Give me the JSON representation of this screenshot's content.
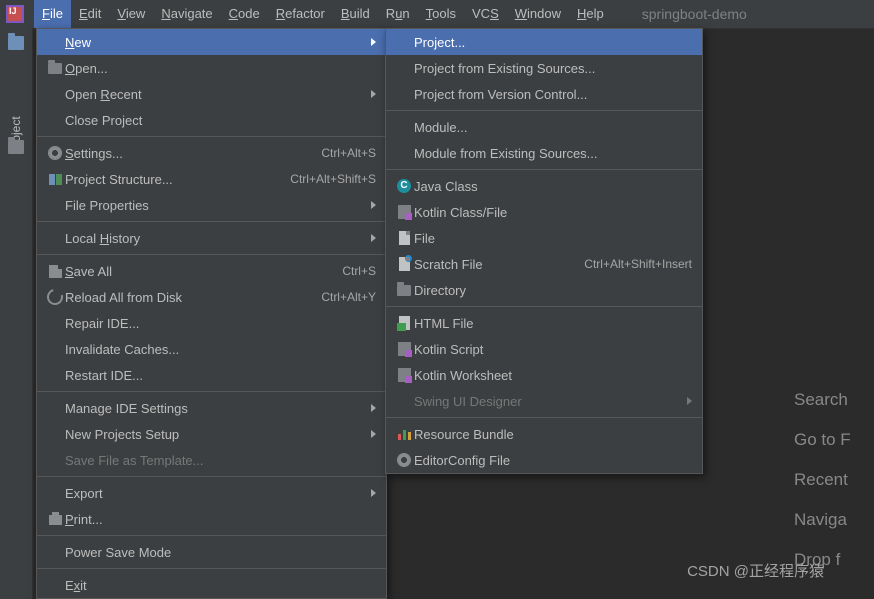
{
  "app": {
    "project_name": "springboot-demo"
  },
  "menubar": {
    "file": "File",
    "edit": "Edit",
    "view": "View",
    "navigate": "Navigate",
    "code": "Code",
    "refactor": "Refactor",
    "build": "Build",
    "run": "Run",
    "tools": "Tools",
    "vcs": "VCS",
    "window": "Window",
    "help": "Help"
  },
  "tool_stripe": {
    "project_label": "Project"
  },
  "file_menu": {
    "new": "New",
    "open": "Open...",
    "open_recent": "Open Recent",
    "close_project": "Close Project",
    "settings": "Settings...",
    "settings_sc": "Ctrl+Alt+S",
    "project_structure": "Project Structure...",
    "project_structure_sc": "Ctrl+Alt+Shift+S",
    "file_properties": "File Properties",
    "local_history": "Local History",
    "save_all": "Save All",
    "save_all_sc": "Ctrl+S",
    "reload_all": "Reload All from Disk",
    "reload_all_sc": "Ctrl+Alt+Y",
    "repair_ide": "Repair IDE...",
    "invalidate_caches": "Invalidate Caches...",
    "restart_ide": "Restart IDE...",
    "manage_ide_settings": "Manage IDE Settings",
    "new_projects_setup": "New Projects Setup",
    "save_file_as_template": "Save File as Template...",
    "export": "Export",
    "print": "Print...",
    "power_save": "Power Save Mode",
    "exit": "Exit"
  },
  "new_menu": {
    "project": "Project...",
    "project_existing": "Project from Existing Sources...",
    "project_vcs": "Project from Version Control...",
    "module": "Module...",
    "module_existing": "Module from Existing Sources...",
    "java_class": "Java Class",
    "kotlin_classfile": "Kotlin Class/File",
    "file": "File",
    "scratch": "Scratch File",
    "scratch_sc": "Ctrl+Alt+Shift+Insert",
    "directory": "Directory",
    "html_file": "HTML File",
    "kotlin_script": "Kotlin Script",
    "kotlin_worksheet": "Kotlin Worksheet",
    "swing_designer": "Swing UI Designer",
    "resource_bundle": "Resource Bundle",
    "editorconfig": "EditorConfig File"
  },
  "background_hints": {
    "search": "Search",
    "goto": "Go to F",
    "recent": "Recent",
    "navigate": "Naviga",
    "drop": "Drop f"
  },
  "watermark": "CSDN @正经程序猿"
}
